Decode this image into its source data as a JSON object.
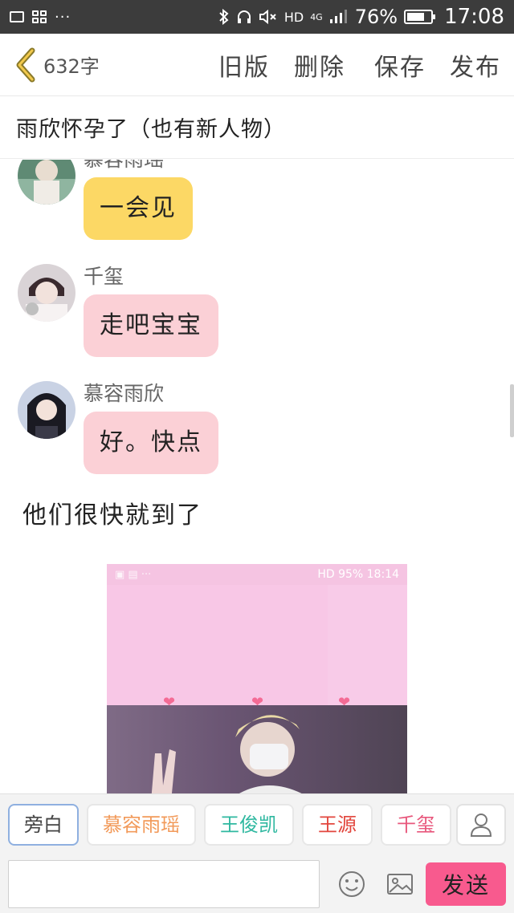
{
  "status_bar": {
    "more": "···",
    "network": "HD",
    "signal_label": "4G",
    "battery": "76%",
    "battery_level": 0.76,
    "time": "17:08"
  },
  "nav": {
    "word_count": "632字",
    "actions": [
      "旧版",
      "删除",
      "保存",
      "发布"
    ]
  },
  "story_title": "雨欣怀孕了（也有新人物）",
  "messages": [
    {
      "sender": "慕容雨瑶",
      "text": "一会见",
      "color": "#fcd865"
    },
    {
      "sender": "千玺",
      "text": "走吧宝宝",
      "color": "#fbd0d6"
    },
    {
      "sender": "慕容雨欣",
      "text": "好。快点",
      "color": "#fbd0d6"
    }
  ],
  "narration": "他们很快就到了",
  "embedded_image": {
    "status_right": "HD 95% 18:14"
  },
  "roles": [
    "旁白",
    "慕容雨瑶",
    "王俊凯",
    "王源",
    "千玺"
  ],
  "input": {
    "placeholder": "",
    "value": ""
  },
  "send_label": "发送"
}
